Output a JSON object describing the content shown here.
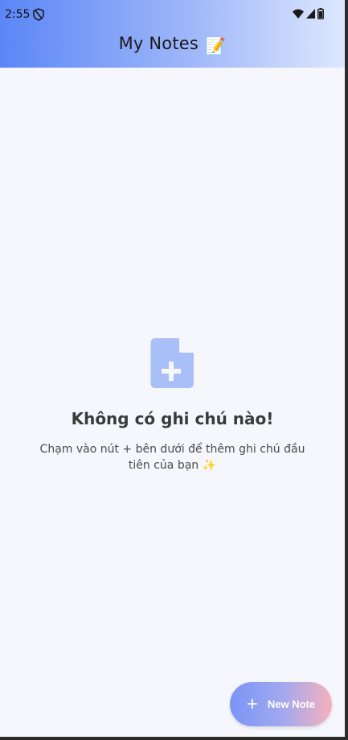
{
  "status_bar": {
    "time": "2:55",
    "left_icon": "shield-icon",
    "right_icons": [
      "wifi-icon",
      "signal-icon",
      "battery-icon"
    ]
  },
  "app_bar": {
    "title": "My Notes",
    "title_emoji": "📝"
  },
  "empty_state": {
    "icon": "add-document-icon",
    "title": "Không có ghi chú nào!",
    "subtitle": "Chạm vào nút + bên dưới để thêm ghi chú đầu tiên của bạn ✨"
  },
  "fab": {
    "icon_symbol": "+",
    "label": "New Note"
  },
  "colors": {
    "appbar_start": "#5b86f7",
    "appbar_end": "#dde7fe",
    "background": "#f6f7fc",
    "icon_tint": "#a9bff8",
    "fab_start": "#7b95f6",
    "fab_end": "#f6b1bd"
  }
}
